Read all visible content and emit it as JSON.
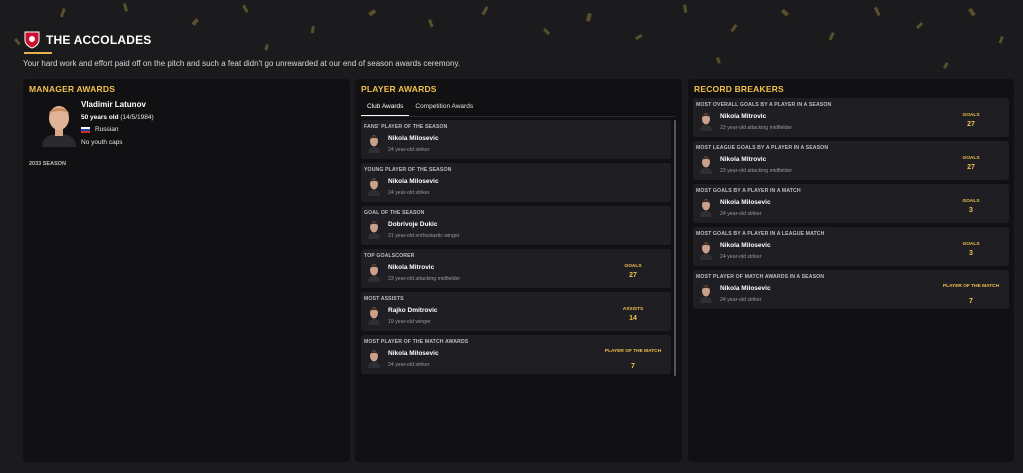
{
  "header": {
    "title": "THE ACCOLADES",
    "subtitle": "Your hard work and effort paid off on the pitch and such a feat didn't go unrewarded at our end of season awards ceremony."
  },
  "colors": {
    "accent": "#f2c04d",
    "background": "#1b1b1e",
    "panel": "#111113",
    "card": "#1f1f23",
    "badge_red": "#c8102e"
  },
  "manager": {
    "title": "MANAGER AWARDS",
    "name": "Vladimir Latunov",
    "age_label": "50 years old",
    "dob": " (14/5/1984)",
    "nationality": "Russian",
    "flag_icon": "russia-flag-icon",
    "caps": "No youth caps",
    "season": "2033 SEASON"
  },
  "player_awards": {
    "title": "PLAYER AWARDS",
    "tabs": [
      {
        "label": "Club Awards",
        "active": true
      },
      {
        "label": "Competition Awards",
        "active": false
      }
    ],
    "items": [
      {
        "award": "FANS' PLAYER OF THE SEASON",
        "name": "Nikola Milosevic",
        "desc": "24 year-old striker",
        "stat_label": "",
        "stat_value": ""
      },
      {
        "award": "YOUNG PLAYER OF THE SEASON",
        "name": "Nikola Milosevic",
        "desc": "24 year-old striker",
        "stat_label": "",
        "stat_value": ""
      },
      {
        "award": "GOAL OF THE SEASON",
        "name": "Dobrivoje Dukic",
        "desc": "21 year-old enthusiastic winger",
        "stat_label": "",
        "stat_value": ""
      },
      {
        "award": "TOP GOALSCORER",
        "name": "Nikola Mitrovic",
        "desc": "23 year-old attacking midfielder",
        "stat_label": "GOALS",
        "stat_value": "27"
      },
      {
        "award": "MOST ASSISTS",
        "name": "Rajko Dmitrovic",
        "desc": "19 year-old winger",
        "stat_label": "ASSISTS",
        "stat_value": "14"
      },
      {
        "award": "MOST PLAYER OF THE MATCH AWARDS",
        "name": "Nikola Milosevic",
        "desc": "24 year-old striker",
        "stat_label": "PLAYER OF THE MATCH",
        "stat_value": "7"
      }
    ]
  },
  "record_breakers": {
    "title": "RECORD BREAKERS",
    "items": [
      {
        "award": "MOST OVERALL GOALS BY A PLAYER IN A SEASON",
        "name": "Nikola Mitrovic",
        "desc": "23 year-old attacking midfielder",
        "stat_label": "GOALS",
        "stat_value": "27"
      },
      {
        "award": "MOST LEAGUE GOALS BY A PLAYER IN A SEASON",
        "name": "Nikola Mitrovic",
        "desc": "23 year-old attacking midfielder",
        "stat_label": "GOALS",
        "stat_value": "27"
      },
      {
        "award": "MOST GOALS BY A PLAYER IN A MATCH",
        "name": "Nikola Milosevic",
        "desc": "24 year-old striker",
        "stat_label": "GOALS",
        "stat_value": "3"
      },
      {
        "award": "MOST GOALS BY A PLAYER IN A LEAGUE MATCH",
        "name": "Nikola Milosevic",
        "desc": "24 year-old striker",
        "stat_label": "GOALS",
        "stat_value": "3"
      },
      {
        "award": "MOST PLAYER OF MATCH AWARDS IN A SEASON",
        "name": "Nikola Milosevic",
        "desc": "24 year-old striker",
        "stat_label": "PLAYER OF THE MATCH",
        "stat_value": "7"
      }
    ]
  }
}
